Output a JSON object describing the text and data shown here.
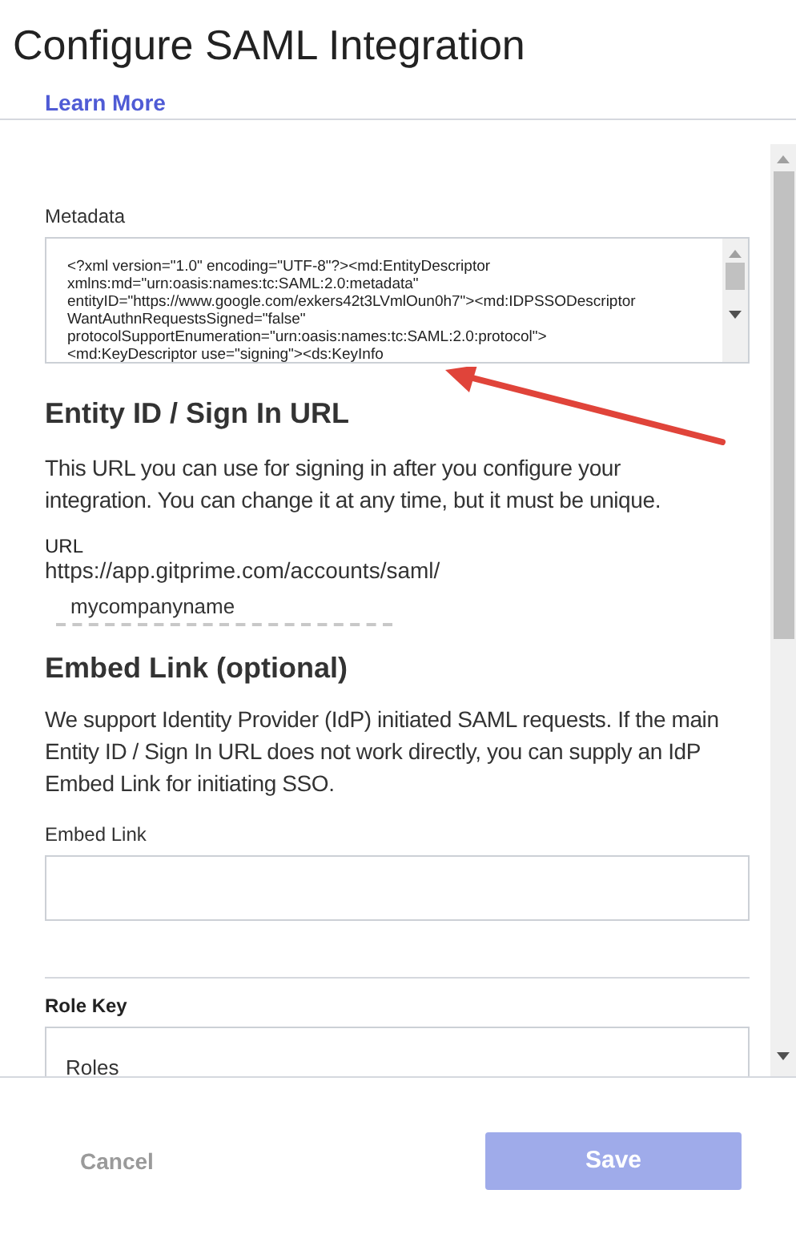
{
  "dialog": {
    "title": "Configure SAML Integration",
    "learn_more": "Learn More"
  },
  "metadata": {
    "label": "Metadata",
    "lines": [
      "<?xml version=\"1.0\" encoding=\"UTF-8\"?><md:EntityDescriptor",
      "xmlns:md=\"urn:oasis:names:tc:SAML:2.0:metadata\"",
      "entityID=\"https://www.google.com/exkers42t3LVmlOun0h7\"><md:IDPSSODescriptor",
      "WantAuthnRequestsSigned=\"false\"",
      "protocolSupportEnumeration=\"urn:oasis:names:tc:SAML:2.0:protocol\">",
      "<md:KeyDescriptor use=\"signing\"><ds:KeyInfo"
    ]
  },
  "entity": {
    "heading": "Entity ID / Sign In URL",
    "description": "This URL you can use for signing in after you configure your integration. You can change it at any time, but it must be unique.",
    "url_label": "URL",
    "url": "https://app.gitprime.com/accounts/saml/",
    "slug": "mycompanyname"
  },
  "embed": {
    "heading": "Embed Link (optional)",
    "description": "We support Identity Provider (IdP) initiated SAML requests. If the main Entity ID / Sign In URL does not work directly, you can supply an IdP Embed Link for initiating SSO.",
    "field_label": "Embed Link"
  },
  "role_key": {
    "label": "Role Key",
    "value": "Roles"
  },
  "footer": {
    "cancel": "Cancel",
    "save": {
      "label": "Save",
      "disabled": true
    }
  }
}
